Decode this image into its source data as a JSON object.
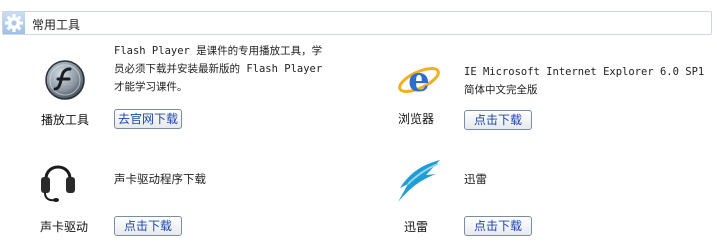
{
  "header": {
    "title": "常用工具",
    "icon": "gear-icon"
  },
  "items": [
    {
      "name": "播放工具",
      "icon": "flash-player-icon",
      "desc_lines": [
        "Flash Player 是课件的专用播放工具，学",
        "员必须下载并安装最新版的 Flash Player",
        "才能学习课件。"
      ],
      "button": "去官网下载"
    },
    {
      "name": "浏览器",
      "icon": "internet-explorer-icon",
      "desc_lines": [
        "IE Microsoft Internet Explorer 6.0 SP1",
        "简体中文完全版"
      ],
      "button": "点击下载"
    },
    {
      "name": "声卡驱动",
      "icon": "headset-icon",
      "desc_lines": [
        "声卡驱动程序下载"
      ],
      "button": "点击下载"
    },
    {
      "name": "迅雷",
      "icon": "thunder-icon",
      "desc_lines": [
        "迅雷"
      ],
      "button": "点击下载"
    }
  ]
}
